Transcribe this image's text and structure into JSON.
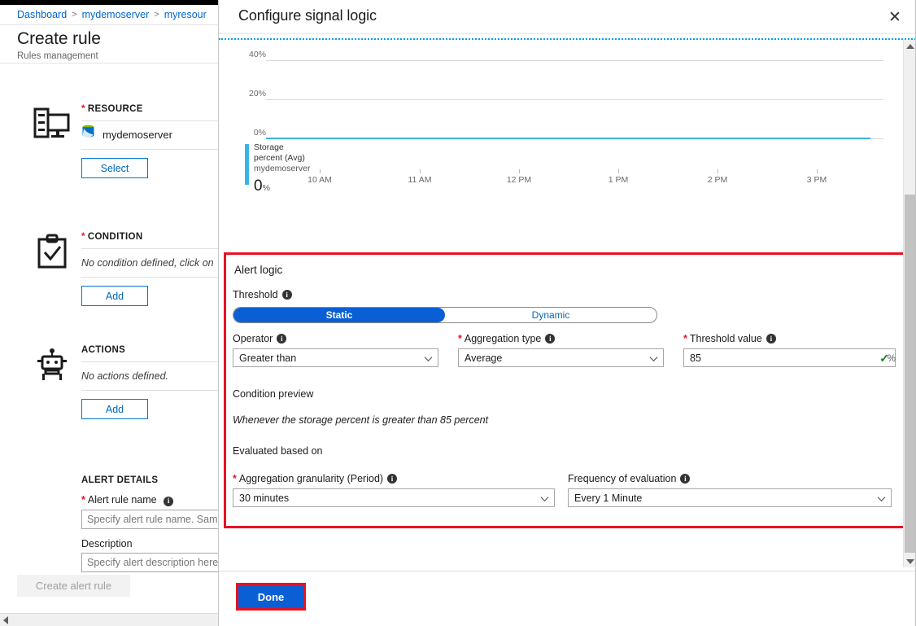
{
  "breadcrumb": {
    "items": [
      "Dashboard",
      "mydemoserver",
      "myresour"
    ],
    "separator": ">"
  },
  "blade": {
    "title": "Create rule",
    "subtitle": "Rules management",
    "sections": [
      {
        "icon": "resource-icon",
        "label": "RESOURCE",
        "required": true,
        "value": "mydemoserver",
        "value_icon": "database-icon",
        "button": "Select"
      },
      {
        "icon": "clipboard-check-icon",
        "label": "CONDITION",
        "required": true,
        "value": "No condition defined, click on",
        "button": "Add"
      },
      {
        "icon": "robot-icon",
        "label": "ACTIONS",
        "required": false,
        "value": "No actions defined.",
        "button": "Add"
      }
    ],
    "alert_details": {
      "heading": "ALERT DETAILS",
      "name_label": "Alert rule name",
      "name_required": true,
      "name_value": "",
      "name_placeholder": "Specify alert rule name. Sampl",
      "description_label": "Description",
      "description_value": "",
      "description_placeholder": "Specify alert description here"
    },
    "create_button": "Create alert rule"
  },
  "modal": {
    "title": "Configure signal logic",
    "close_label": "✕",
    "done_button": "Done"
  },
  "chart_data": {
    "type": "line",
    "title": "",
    "xlabel": "",
    "ylabel": "",
    "ylim": [
      0,
      50
    ],
    "yticks": [
      0,
      20,
      40
    ],
    "ytick_labels": [
      "0%",
      "20%",
      "40%"
    ],
    "x": [
      "10 AM",
      "11 AM",
      "12 PM",
      "1 PM",
      "2 PM",
      "3 PM"
    ],
    "xtick_labels": [
      "10 AM",
      "11 AM",
      "12 PM",
      "1 PM",
      "2 PM",
      "3 PM"
    ],
    "grid": true,
    "legend_position": "bottom-left",
    "series": [
      {
        "name": "Storage percent (Avg)",
        "resource": "mydemoserver",
        "color": "#3bb4e5",
        "current_value": "0",
        "unit": "%",
        "values": [
          0,
          0,
          0,
          0,
          0,
          0
        ]
      }
    ]
  },
  "alert_logic": {
    "heading": "Alert logic",
    "threshold": {
      "label": "Threshold",
      "options": [
        "Static",
        "Dynamic"
      ],
      "selected": "Static"
    },
    "operator": {
      "label": "Operator",
      "required": false,
      "value": "Greater than"
    },
    "aggregation_type": {
      "label": "Aggregation type",
      "required": true,
      "value": "Average"
    },
    "threshold_value": {
      "label": "Threshold value",
      "required": true,
      "value": "85",
      "unit": "%",
      "valid": true,
      "valid_mark": "✓"
    },
    "condition_preview": {
      "label": "Condition preview",
      "text": "Whenever the storage percent is greater than 85 percent"
    },
    "evaluated_based_on": {
      "label": "Evaluated based on",
      "granularity": {
        "label": "Aggregation granularity (Period)",
        "required": true,
        "value": "30 minutes"
      },
      "frequency": {
        "label": "Frequency of evaluation",
        "required": false,
        "value": "Every 1 Minute"
      }
    }
  },
  "colors": {
    "accent": "#0078d4",
    "primary_button": "#0b5fd4",
    "highlight_border": "#e81123",
    "series": "#3bb4e5",
    "valid": "#107c10",
    "required_star": "#e81123"
  }
}
